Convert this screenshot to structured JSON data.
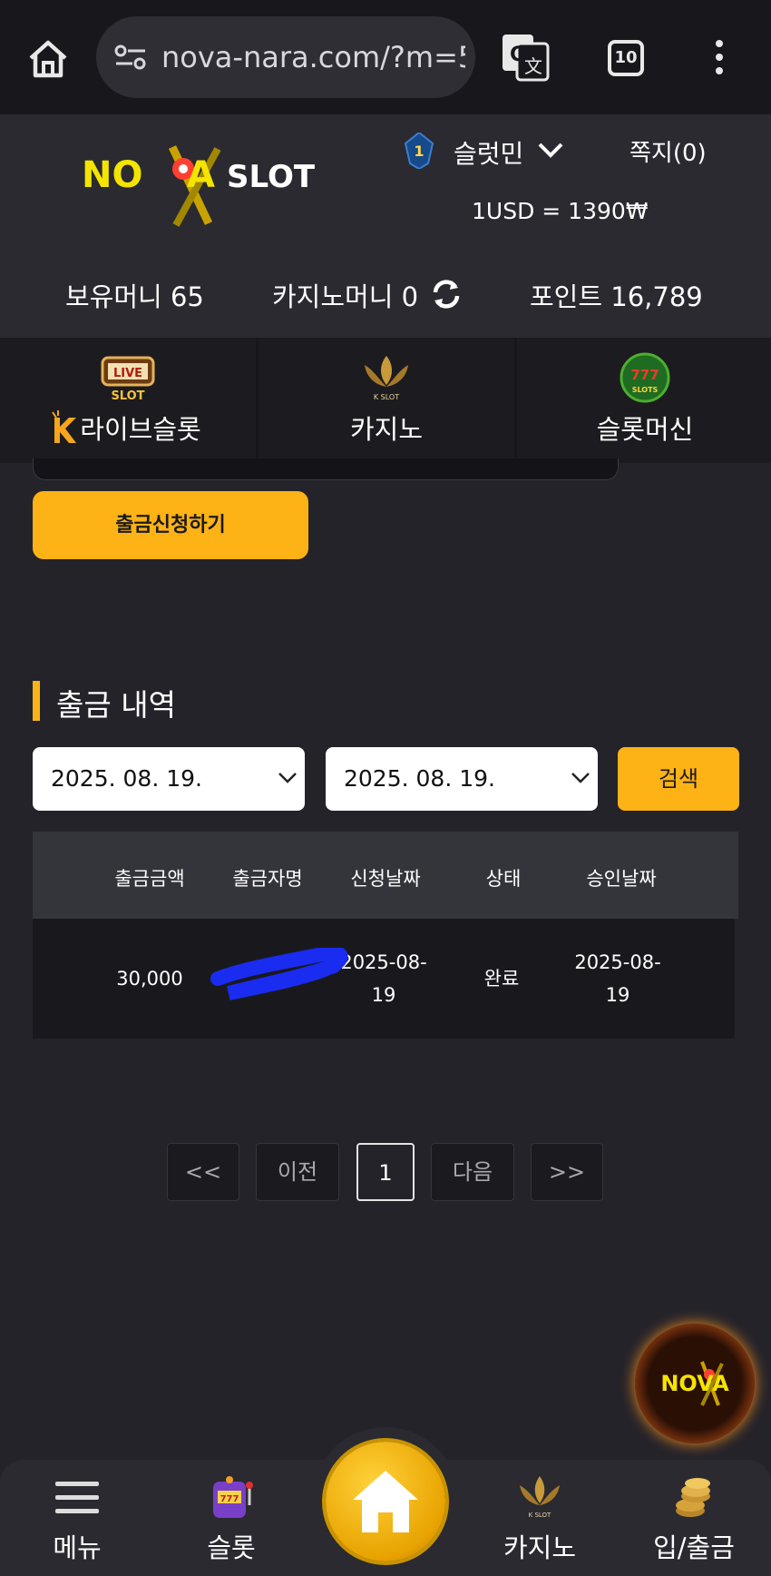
{
  "browser": {
    "url": "nova-nara.com/?m=5",
    "tab_count": "10"
  },
  "header": {
    "logo_text_left": "NO",
    "logo_text_mid": "A",
    "logo_text_right": "SLOT",
    "rank_level": "1",
    "username": "슬럿민",
    "messages": "쪽지(0)",
    "exchange_rate": "1USD = 1390₩",
    "holding_money": "보유머니 65",
    "casino_money": "카지노머니 0",
    "points": "포인트 16,789"
  },
  "game_nav": {
    "items": [
      {
        "label": "라이브슬롯",
        "icon_text": "LIVE SLOT"
      },
      {
        "label": "카지노",
        "icon_text": "K SLOT"
      },
      {
        "label": "슬롯머신",
        "icon_text": "777 SLOTS"
      }
    ]
  },
  "withdraw": {
    "button_label": "출금신청하기"
  },
  "history": {
    "title": "출금 내역",
    "date_from": "2025. 08. 19.",
    "date_to": "2025. 08. 19.",
    "search_label": "검색",
    "columns": [
      "출금금액",
      "출금자명",
      "신청날짜",
      "상태",
      "승인날짜"
    ],
    "rows": [
      {
        "amount": "30,000",
        "name": "",
        "request_date_1": "2025-08-",
        "request_date_2": "19",
        "status": "완료",
        "approve_date_1": "2025-08-",
        "approve_date_2": "19"
      }
    ]
  },
  "pagination": {
    "first": "<<",
    "prev": "이전",
    "current": "1",
    "next": "다음",
    "last": ">>"
  },
  "fab": {
    "logo_text": "NOVA"
  },
  "bottom_nav": {
    "items": [
      {
        "label": "메뉴",
        "icon": "hamburger-icon"
      },
      {
        "label": "슬롯",
        "icon": "slot-machine-icon"
      },
      {
        "label": "",
        "icon": "home-icon"
      },
      {
        "label": "카지노",
        "icon": "casino-icon"
      },
      {
        "label": "입/출금",
        "icon": "coins-icon"
      }
    ]
  },
  "colors": {
    "accent": "#fdb216",
    "background": "#24232a",
    "header_bg": "#2a2a30",
    "redaction": "#1a2cf0"
  }
}
